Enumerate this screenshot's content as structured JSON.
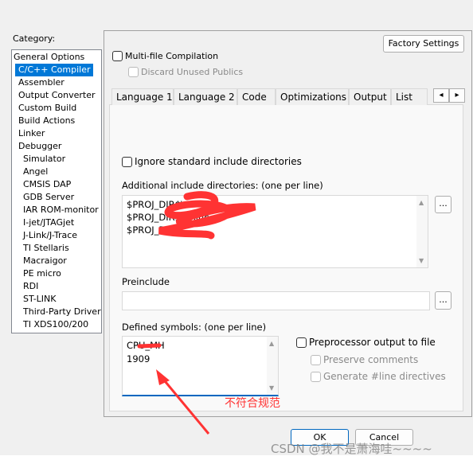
{
  "category": {
    "label": "Category:",
    "items": [
      {
        "label": "General Options",
        "level": 0
      },
      {
        "label": "C/C++ Compiler",
        "level": 1,
        "selected": true
      },
      {
        "label": "Assembler",
        "level": 1
      },
      {
        "label": "Output Converter",
        "level": 1
      },
      {
        "label": "Custom Build",
        "level": 1
      },
      {
        "label": "Build Actions",
        "level": 1
      },
      {
        "label": "Linker",
        "level": 1
      },
      {
        "label": "Debugger",
        "level": 1
      },
      {
        "label": "Simulator",
        "level": 2
      },
      {
        "label": "Angel",
        "level": 2
      },
      {
        "label": "CMSIS DAP",
        "level": 2
      },
      {
        "label": "GDB Server",
        "level": 2
      },
      {
        "label": "IAR ROM-monitor",
        "level": 2
      },
      {
        "label": "I-jet/JTAGjet",
        "level": 2
      },
      {
        "label": "J-Link/J-Trace",
        "level": 2
      },
      {
        "label": "TI Stellaris",
        "level": 2
      },
      {
        "label": "Macraigor",
        "level": 2
      },
      {
        "label": "PE micro",
        "level": 2
      },
      {
        "label": "RDI",
        "level": 2
      },
      {
        "label": "ST-LINK",
        "level": 2
      },
      {
        "label": "Third-Party Driver",
        "level": 2
      },
      {
        "label": "TI XDS100/200",
        "level": 2
      }
    ]
  },
  "factory_settings": "Factory Settings",
  "multi_file": {
    "label": "Multi-file Compilation",
    "checked": false
  },
  "discard_publics": {
    "label": "Discard Unused Publics",
    "checked": false,
    "disabled": true
  },
  "tabs": [
    "Language 1",
    "Language 2",
    "Code",
    "Optimizations",
    "Output",
    "List"
  ],
  "tab_scroll": {
    "left": "◂",
    "right": "▸"
  },
  "ignore_std": {
    "label": "Ignore standard include directories",
    "checked": false
  },
  "include_dirs": {
    "label": "Additional include directories: (one per line)",
    "lines": [
      "$PROJ_DIR$\\",
      "$PROJ_DIR$\\...\\inc",
      "$PROJ_DIR$\\"
    ],
    "browse": "..."
  },
  "preinclude": {
    "label": "Preinclude",
    "value": "",
    "browse": "..."
  },
  "defined_symbols": {
    "label": "Defined symbols: (one per line)",
    "lines": [
      "CPU_MH",
      "1909"
    ]
  },
  "preprocessor": {
    "label": "Preprocessor output to file",
    "checked": false
  },
  "preserve_comments": {
    "label": "Preserve comments",
    "checked": false,
    "disabled": true
  },
  "generate_line": {
    "label": "Generate #line directives",
    "checked": false,
    "disabled": true
  },
  "annotation": {
    "text": "不符合规范",
    "color": "#ff3333"
  },
  "ok": "OK",
  "cancel": "Cancel",
  "watermark": "CSDN @我不是萧海哇~~~~",
  "colors": {
    "selection": "#0078d7",
    "focus": "#0067c0"
  }
}
